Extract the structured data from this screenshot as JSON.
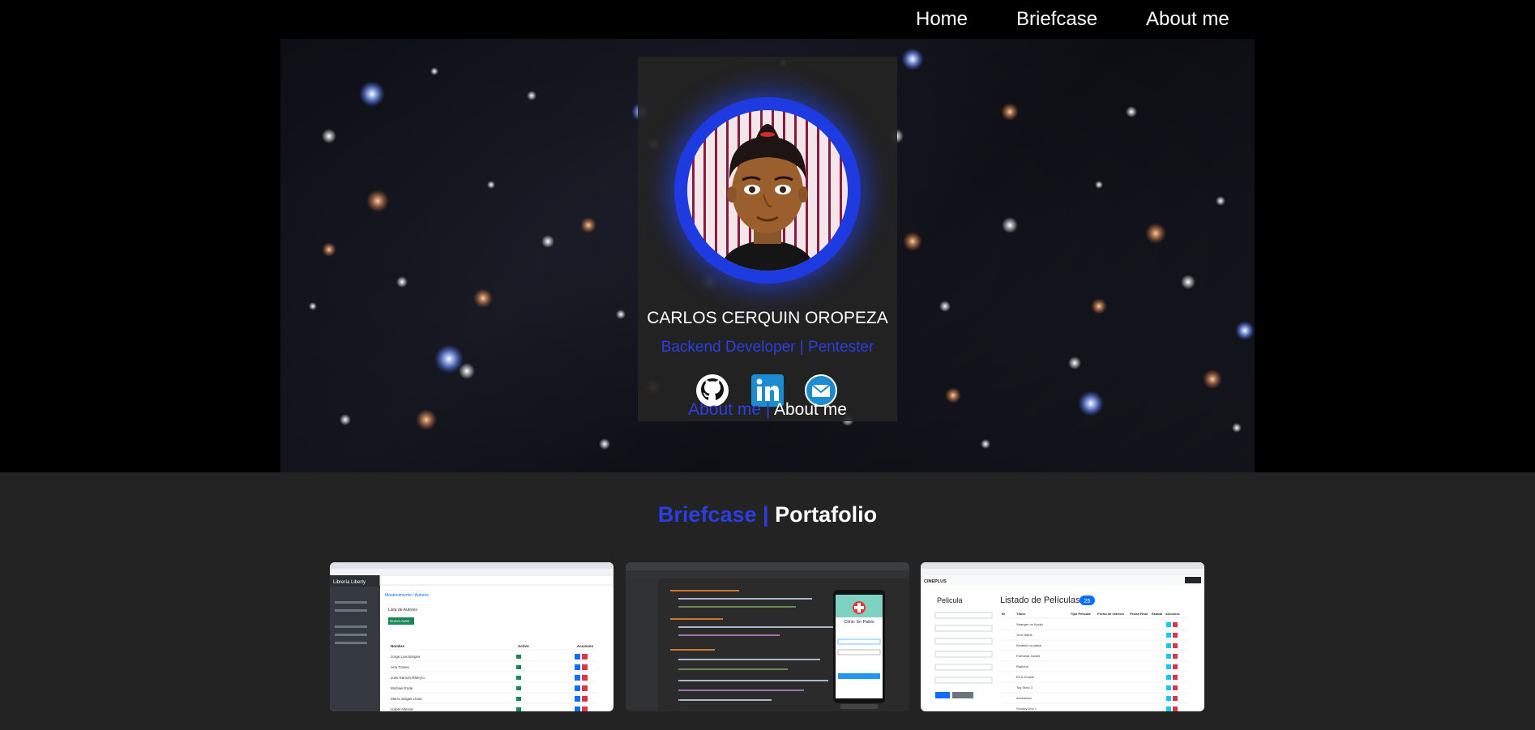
{
  "nav": {
    "items": [
      {
        "label": "Home"
      },
      {
        "label": "Briefcase"
      },
      {
        "label": "About me"
      }
    ]
  },
  "profile": {
    "name": "CARLOS CERQUIN OROPEZA",
    "role": "Backend Developer | Pentester",
    "links_blue": "About me |",
    "links_white": "About me",
    "socials": [
      {
        "icon": "github-icon"
      },
      {
        "icon": "linkedin-icon"
      },
      {
        "icon": "email-icon"
      }
    ]
  },
  "portfolio": {
    "heading_blue": "Briefcase |",
    "heading_white": "Portafolio",
    "projects": [
      {
        "app_title": "Librería Liberty",
        "breadcrumb": "Mantenimiento / Autores",
        "section": "Lista de Autores",
        "button": "Nuevo Autor",
        "columns": [
          "Nombre",
          "Activo",
          "Acciones"
        ],
        "rows": [
          "Jorge Luis Borges",
          "Ana Tzarev",
          "Julio Ramón Ribeyro",
          "Michael Ende",
          "Mario Vargas Llosa",
          "Isabel Allende"
        ]
      },
      {
        "app_title": "Clinic Sn Pablo"
      },
      {
        "brand": "CINEPLUS",
        "form_title": "Pelicula",
        "list_title": "Listado de Películas",
        "count": "25",
        "columns": [
          "ID",
          "Título",
          "Tipo Película",
          "Fecha de estreno",
          "Fecha Final",
          "Estado",
          "Acciones"
        ],
        "rows": [
          "Stranger no Kyojin",
          "Your Name",
          "Kimetsu no yaiba",
          "Fullmetal Jacket",
          "Radiohe",
          "Elf & Dunkle",
          "Toy Story 3",
          "Animacion",
          "Scooby Doo 1"
        ]
      }
    ]
  },
  "colors": {
    "accent_blue": "#2b3fe0",
    "nav_background": "#000000",
    "page_background": "#232323"
  }
}
